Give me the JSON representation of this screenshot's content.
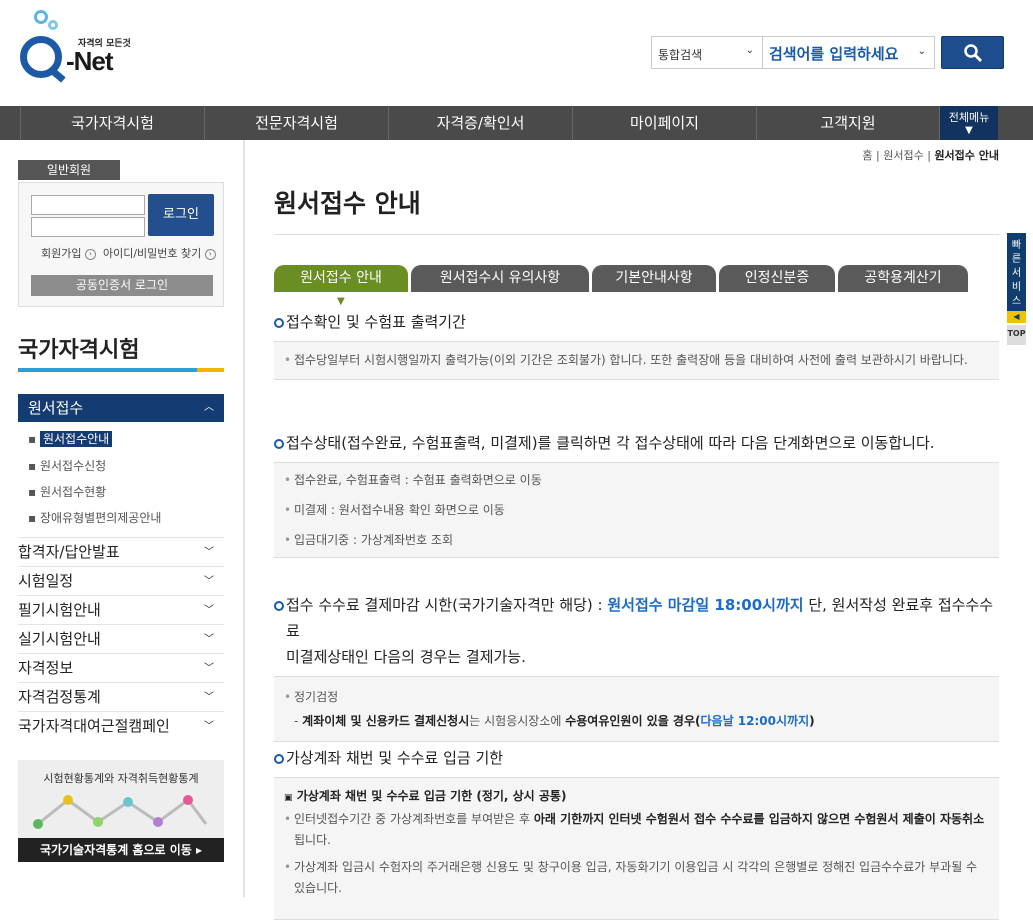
{
  "logo": {
    "tagline": "자격의 모든것",
    "name": "-Net"
  },
  "search": {
    "scope": "통합검색",
    "placeholder": "검색어를 입력하세요"
  },
  "gnb": {
    "items": [
      "국가자격시험",
      "전문자격시험",
      "자격증/확인서",
      "마이페이지",
      "고객지원"
    ],
    "all_menu": "전체메뉴"
  },
  "login": {
    "label": "일반회원",
    "button": "로그인",
    "join": "회원가입",
    "find": "아이디/비밀번호 찾기",
    "cert": "공동인증서 로그인"
  },
  "sidebar": {
    "title": "국가자격시험",
    "active": "원서접수",
    "subs": [
      "원서접수안내",
      "원서접수신청",
      "원서접수현황",
      "장애유형별편의제공안내"
    ],
    "menus": [
      "합격자/답안발표",
      "시험일정",
      "필기시험안내",
      "실기시험안내",
      "자격정보",
      "자격검정통계",
      "국가자격대여근절캠페인"
    ],
    "banner_title": "시험현황통계와 자격취득현황통계",
    "banner_link": "국가기술자격통계 홈으로 이동"
  },
  "breadcrumb": {
    "home": "홈",
    "parent": "원서접수",
    "current": "원서접수 안내"
  },
  "page_title": "원서접수 안내",
  "tabs": [
    "원서접수 안내",
    "원서접수시 유의사항",
    "기본안내사항",
    "인정신분증",
    "공학용계산기"
  ],
  "sections": {
    "s1": {
      "title": "접수확인 및 수험표 출력기간",
      "items": [
        "접수당일부터 시험시행일까지 출력가능(이외 기간은 조회불가) 합니다. 또한 출력장애 등을 대비하여 사전에 출력 보관하시기 바랍니다."
      ]
    },
    "s2": {
      "title": "접수상태(접수완료, 수험표출력, 미결제)를 클릭하면 각 접수상태에 따라 다음 단계화면으로 이동합니다.",
      "items": [
        "접수완료, 수험표출력 : 수험표 출력화면으로 이동",
        "미결제 : 원서접수내용 확인 화면으로 이동",
        "입금대기중 : 가상계좌번호 조회"
      ]
    },
    "s3": {
      "title_a": "접수 수수료 결제마감 시한(국가기술자격만 해당) : ",
      "title_b": "원서접수 마감일 18:00시까지",
      "title_c": " 단, 원서작성 완료후 접수수수료",
      "title_d": "미결제상태인 다음의 경우는 결제가능.",
      "item": "정기검정",
      "sub_a": "- ",
      "sub_b": "계좌이체 및 신용카드 결제신청시",
      "sub_c": "는 시험응시장소에 ",
      "sub_d": "수용여유인원이 있을 경우",
      "sub_e": "(",
      "sub_f": "다음날 12:00시까지",
      "sub_g": ")"
    },
    "s4": {
      "title": "가상계좌 채번 및 수수료 입금 기한",
      "subtitle": "가상계좌 채번 및 수수료 입금 기한 (정기, 상시 공통)",
      "i1_a": "인터넷접수기간 중 가상계좌번호를 부여받은 후 ",
      "i1_b": "아래 기한까지 인터넷 수험원서 접수 수수료를 입금하지 않으면 수험원서 제출이 자동취소",
      "i1_c": " 됩니다.",
      "i2": "가상계좌 입금시 수험자의 주거래은행 신용도 및 창구이용 입금, 자동화기기 이용입금 시 각각의 은행별로 정해진 입금수수료가 부과될 수 있습니다."
    }
  },
  "quick": {
    "label": "빠른서비스",
    "top": "TOP"
  }
}
